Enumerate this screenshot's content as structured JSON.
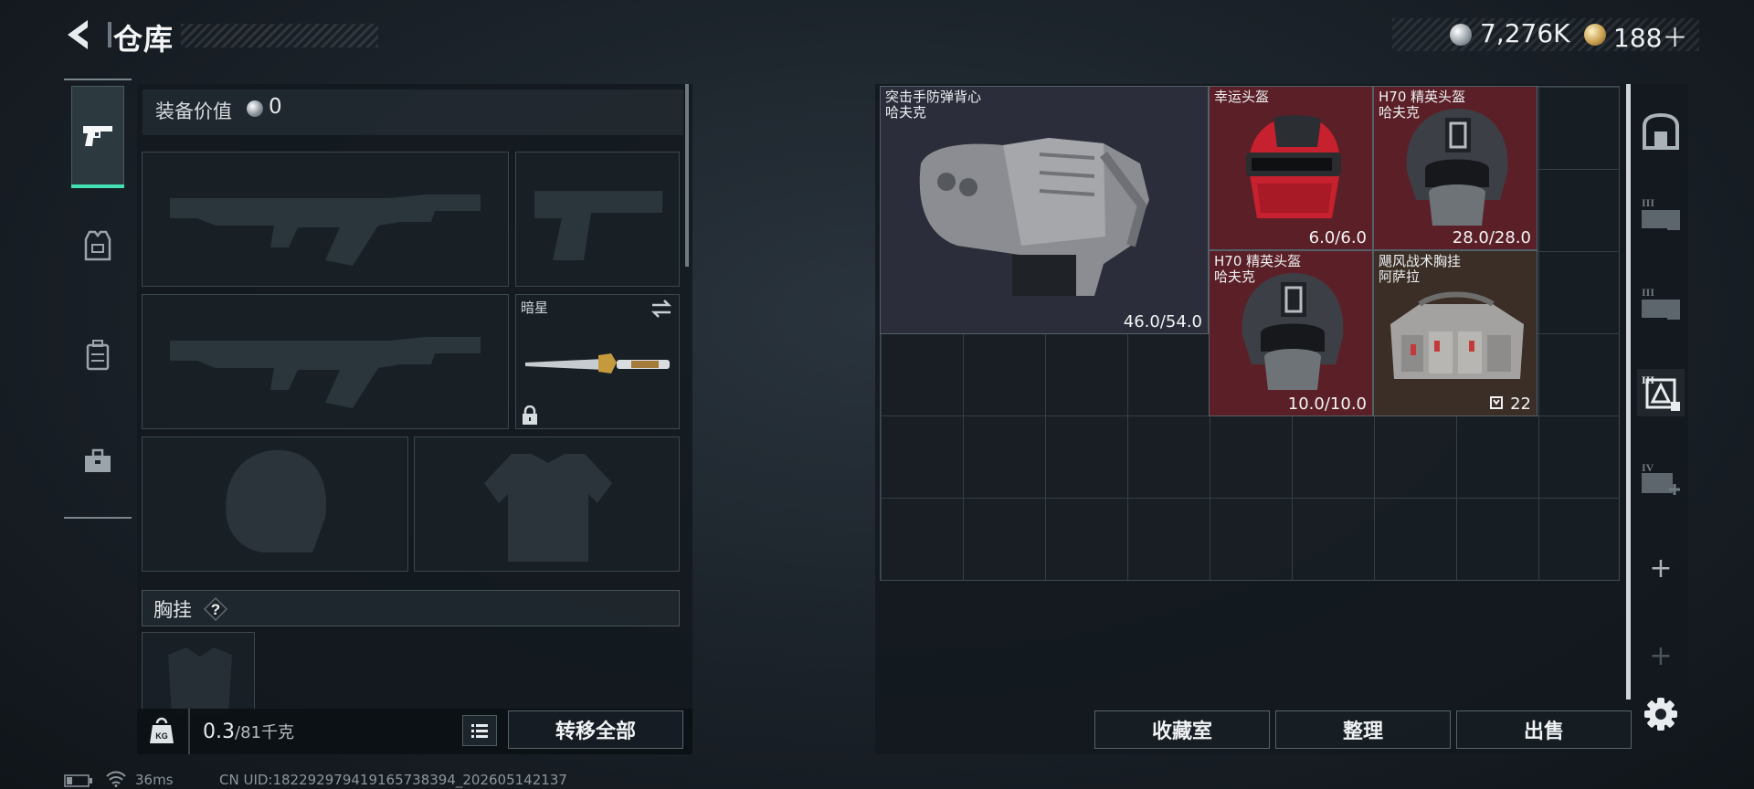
{
  "header": {
    "title": "仓库",
    "currency_silver": "7,276K",
    "currency_gold": "188＋"
  },
  "nav": {
    "tabs": [
      {
        "name": "weapons",
        "icon": "pistol-icon",
        "active": true
      },
      {
        "name": "armor",
        "icon": "armor-vest-icon",
        "active": false
      },
      {
        "name": "backpack",
        "icon": "backpack-icon",
        "active": false
      },
      {
        "name": "tools",
        "icon": "toolbox-icon",
        "active": false
      }
    ],
    "accent_color": "#43e0b4"
  },
  "loadout": {
    "value_label": "装备价值",
    "value_amount": "0",
    "melee_name": "暗星",
    "chest_rig_label": "胸挂",
    "help_symbol": "?",
    "weight_current": "0.3",
    "weight_capacity": "/81千克",
    "weight_icon_text": "KG",
    "transfer_all_label": "转移全部"
  },
  "stash": {
    "items": [
      {
        "name_line1": "突击手防弹背心",
        "name_line2": "哈夫克",
        "durability": "46.0/54.0",
        "color": "#2b2d3a"
      },
      {
        "name_line1": "幸运头盔",
        "name_line2": "",
        "durability": "6.0/6.0",
        "color": "#5b2027"
      },
      {
        "name_line1": "H70 精英头盔",
        "name_line2": "哈夫克",
        "durability": "28.0/28.0",
        "color": "#5b2027"
      },
      {
        "name_line1": "H70 精英头盔",
        "name_line2": "哈夫克",
        "durability": "10.0/10.0",
        "color": "#5b2027"
      },
      {
        "name_line1": "飓风战术胸挂",
        "name_line2": "阿萨拉",
        "durability": "22",
        "color": "#3b2e26"
      }
    ],
    "storage_room_label": "收藏室",
    "sort_label": "整理",
    "sell_label": "出售"
  },
  "sidebar": {
    "tier_labels": [
      "III",
      "III",
      "III",
      "IV"
    ],
    "add_symbol": "+"
  },
  "footer": {
    "ping": "36ms",
    "uid": "CN UID:18229297941916573839​4_202605142137"
  }
}
